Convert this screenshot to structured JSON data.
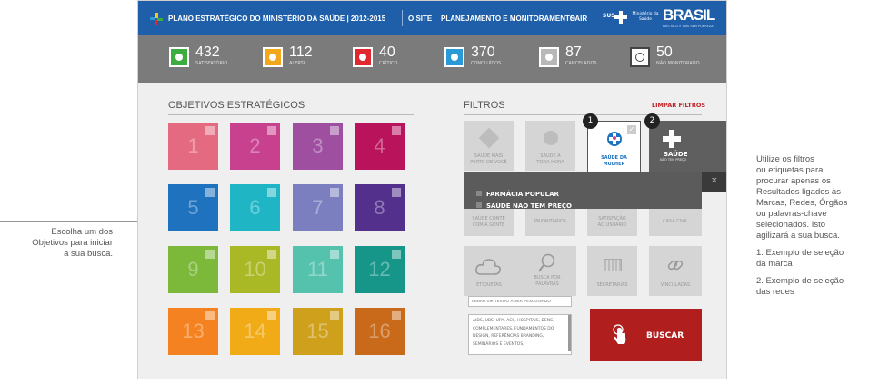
{
  "header": {
    "title": "PLANO ESTRATÉGICO DO MINISTÉRIO DA SAÚDE | 2012-2015",
    "nav": [
      "O SITE",
      "PLANEJAMENTO E MONITORAMENTO",
      "SAIR"
    ],
    "sus": "SUS",
    "ministerio": "Ministério da Saúde",
    "brasil": "BRASIL",
    "brasil_tag": "PAÍS RICO É PAÍS SEM POBREZA"
  },
  "status": [
    {
      "count": "432",
      "label": "SATISFATÓRIO",
      "color": "#3cae3f"
    },
    {
      "count": "112",
      "label": "ALERTA",
      "color": "#f5a71c"
    },
    {
      "count": "40",
      "label": "CRÍTICO",
      "color": "#e0282e"
    },
    {
      "count": "370",
      "label": "CONCLUÍDOS",
      "color": "#2a9ad6"
    },
    {
      "count": "87",
      "label": "CANCELADOS",
      "color": "#b8b8b8"
    },
    {
      "count": "50",
      "label": "NÃO MONITORADO",
      "color": "#ffffff"
    }
  ],
  "objetivos": {
    "title": "OBJETIVOS ESTRATÉGICOS",
    "tiles": [
      "1",
      "2",
      "3",
      "4",
      "5",
      "6",
      "7",
      "8",
      "9",
      "10",
      "11",
      "12",
      "13",
      "14",
      "15",
      "16"
    ],
    "colors": [
      "#e36a80",
      "#c8418f",
      "#9e4fa0",
      "#b8135b",
      "#1f73be",
      "#1fb5c5",
      "#7b7fc0",
      "#53308c",
      "#7cb83a",
      "#a9b825",
      "#55c2ad",
      "#159688",
      "#f58220",
      "#f0ab16",
      "#cfa01c",
      "#c86a1a"
    ]
  },
  "filtros": {
    "title": "FILTROS",
    "clear": "LIMPAR FILTROS",
    "row1": [
      "SAÚDE MAIS PERTO DE VOCÊ",
      "SAÚDE A TODA HORA",
      "SAÚDE DA MULHER",
      "SAÚDE"
    ],
    "saude_sub": "NÃO TEM PREÇO",
    "dropdown": [
      "FARMÁCIA POPULAR",
      "SAÚDE NÃO TEM PREÇO"
    ],
    "row2": [
      "SAÚDE CONTE COM A GENTE",
      "PRIORITÁRIOS",
      "SATISFAÇÃO AO USUÁRIO",
      "CASA CIVIL"
    ],
    "row3": [
      "ETIQUETAS",
      "BUSCA POR PALAVRAS",
      "SECRETARIAS",
      "VINCULADAS"
    ],
    "search_placeholder": "INSIRA UM TERMO A SER PESQUISADO",
    "tags": "AIDS, UBS, UPA, ACS, HOSPITAIS, DENG, COMPLEMENTARES, FUNDAMENTOS DO DESIGN, REFERÊNCIAS BRANDING, SEMINÁRIOS E EVENTOS,",
    "buscar": "BUSCAR",
    "badge1": "1",
    "badge2": "2"
  },
  "notes": {
    "left": [
      "Escolha um dos",
      "Objetivos  para iniciar",
      "a sua busca."
    ],
    "right": [
      "Utilize os filtros",
      "ou etiquetas para",
      "procurar apenas os",
      "Resultados ligados às",
      "Marcas, Redes, Órgãos",
      "ou palavras-chave",
      "selecionados. Isto",
      "agilizará a sua busca."
    ],
    "right2": [
      "1. Exemplo de seleção",
      "da marca"
    ],
    "right3": [
      "2. Exemplo de seleção",
      "das redes"
    ]
  }
}
